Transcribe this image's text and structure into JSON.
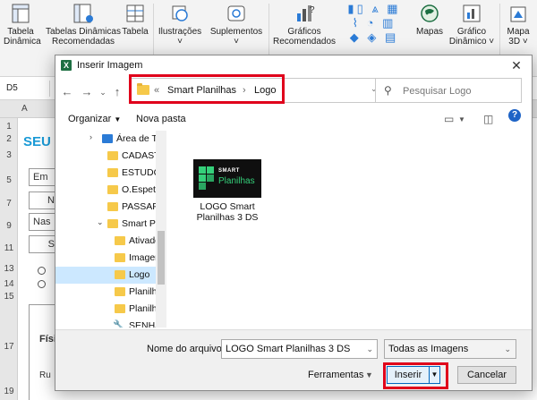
{
  "ribbon": {
    "items": [
      {
        "label": "Tabela\nDinâmica"
      },
      {
        "label": "Tabelas Dinâmicas\nRecomendadas"
      },
      {
        "label": "Tabela"
      },
      {
        "label": "Ilustrações ˅"
      },
      {
        "label": "Suplementos ˅"
      },
      {
        "label": "Gráficos\nRecomendados"
      },
      {
        "label": "Mapas"
      },
      {
        "label": "Gráfico\nDinâmico ˅"
      },
      {
        "label": "Mapa\n3D ˅"
      }
    ]
  },
  "excel": {
    "name_box": "D5",
    "col_a": "A",
    "rows": [
      "1",
      "2",
      "3",
      "5",
      "7",
      "9",
      "11",
      "13",
      "14",
      "15",
      "17",
      "19"
    ],
    "sheet_title": "SEU",
    "cells": [
      "Em",
      "N",
      "Nas",
      "S",
      "Físi",
      "Ru"
    ]
  },
  "dialog": {
    "title": "Inserir Imagem",
    "address": {
      "prefix": "«",
      "segments": [
        "Smart Planilhas",
        "Logo"
      ],
      "separator": "›"
    },
    "search_placeholder": "Pesquisar Logo",
    "toolbar": {
      "organize": "Organizar",
      "new_folder": "Nova pasta"
    },
    "tree": [
      {
        "label": "Área de Tra",
        "kind": "desktop"
      },
      {
        "label": "CADASTI",
        "kind": "folder"
      },
      {
        "label": "ESTUDOS",
        "kind": "folder"
      },
      {
        "label": "O.Espeta",
        "kind": "folder"
      },
      {
        "label": "PASSAPO",
        "kind": "folder"
      },
      {
        "label": "Smart Pla",
        "kind": "folder"
      },
      {
        "label": "Ativado",
        "kind": "folder"
      },
      {
        "label": "Imager",
        "kind": "folder"
      },
      {
        "label": "Logo",
        "kind": "folder",
        "selected": true
      },
      {
        "label": "Planilha",
        "kind": "folder"
      },
      {
        "label": "Planilha",
        "kind": "folder"
      },
      {
        "label": "SENHA",
        "kind": "folder"
      }
    ],
    "file": {
      "name": "LOGO Smart Planilhas 3 DS",
      "thumb_line1": "SMART",
      "thumb_line2": "Planilhas"
    },
    "bottom": {
      "filename_label": "Nome do arquivo:",
      "filename_value": "LOGO Smart Planilhas 3 DS",
      "filetype_value": "Todas as Imagens",
      "tools_label": "Ferramentas",
      "insert_label": "Inserir",
      "cancel_label": "Cancelar"
    }
  },
  "colors": {
    "highlight": "#e0001b",
    "accent": "#0067c0",
    "logo_green": "#35d07a"
  }
}
